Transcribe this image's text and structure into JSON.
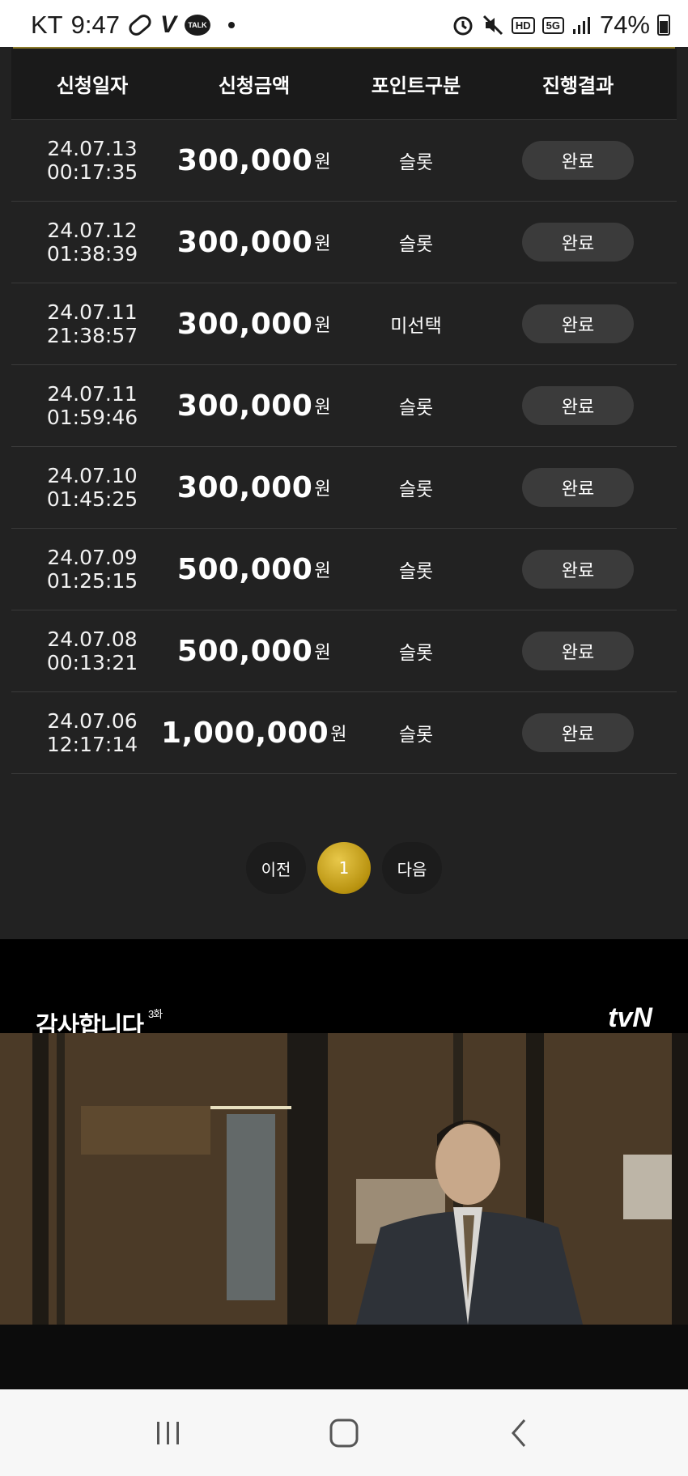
{
  "status_bar": {
    "carrier": "KT",
    "time": "9:47",
    "talk_badge": "TALK",
    "hd_badge": "HD",
    "network": "5G",
    "battery": "74%"
  },
  "table": {
    "headers": [
      "신청일자",
      "신청금액",
      "포인트구분",
      "진행결과"
    ],
    "unit": "원",
    "rows": [
      {
        "date": "24.07.13",
        "time": "00:17:35",
        "amount": "300,000",
        "type": "슬롯",
        "status": "완료"
      },
      {
        "date": "24.07.12",
        "time": "01:38:39",
        "amount": "300,000",
        "type": "슬롯",
        "status": "완료"
      },
      {
        "date": "24.07.11",
        "time": "21:38:57",
        "amount": "300,000",
        "type": "미선택",
        "status": "완료"
      },
      {
        "date": "24.07.11",
        "time": "01:59:46",
        "amount": "300,000",
        "type": "슬롯",
        "status": "완료"
      },
      {
        "date": "24.07.10",
        "time": "01:45:25",
        "amount": "300,000",
        "type": "슬롯",
        "status": "완료"
      },
      {
        "date": "24.07.09",
        "time": "01:25:15",
        "amount": "500,000",
        "type": "슬롯",
        "status": "완료"
      },
      {
        "date": "24.07.08",
        "time": "00:13:21",
        "amount": "500,000",
        "type": "슬롯",
        "status": "완료"
      },
      {
        "date": "24.07.06",
        "time": "12:17:14",
        "amount": "1,000,000",
        "type": "슬롯",
        "status": "완료"
      }
    ]
  },
  "pager": {
    "prev": "이전",
    "current": "1",
    "next": "다음"
  },
  "video": {
    "show_title": "감사합니다",
    "episode": "3화",
    "channel": "tvN"
  },
  "colors": {
    "panel_bg": "#222222",
    "header_bg": "#1a1a1a",
    "accent_gold": "#c9a520",
    "button_bg": "#3b3b3b"
  }
}
